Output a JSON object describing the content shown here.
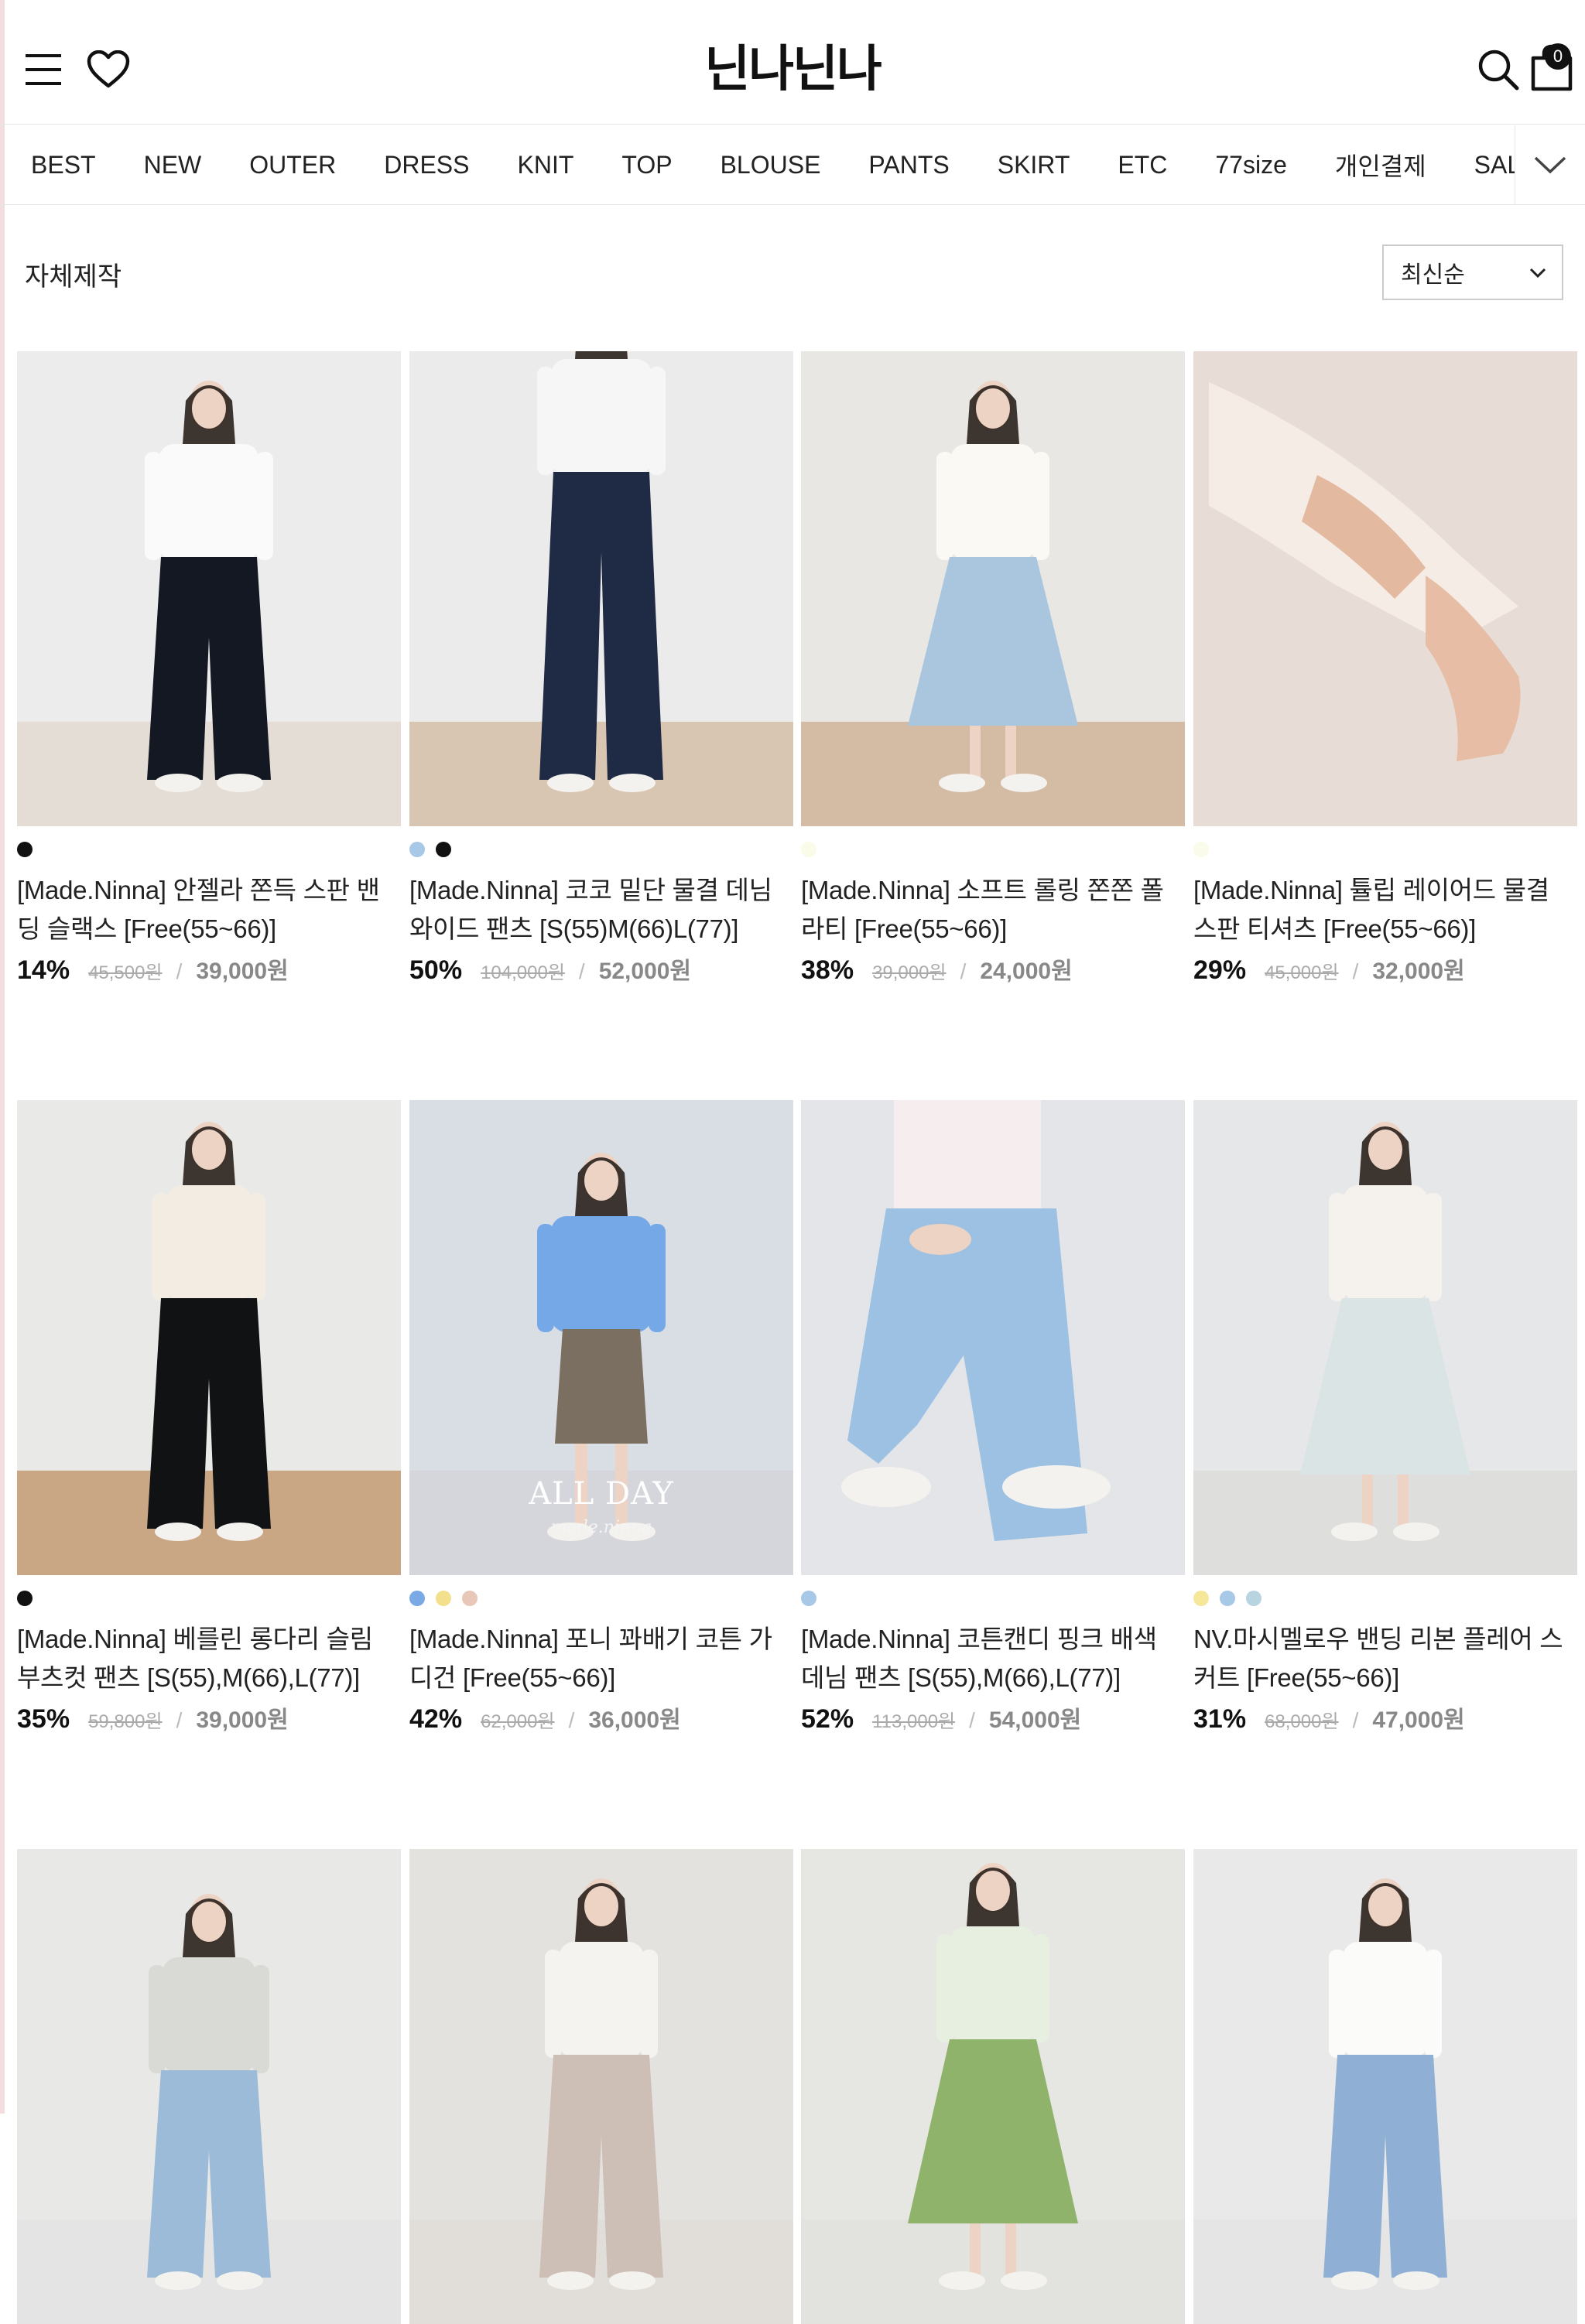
{
  "header": {
    "logo": "닌나닌나",
    "cart_count": "0"
  },
  "nav": {
    "items": [
      "BEST",
      "NEW",
      "OUTER",
      "DRESS",
      "KNIT",
      "TOP",
      "BLOUSE",
      "PANTS",
      "SKIRT",
      "ETC",
      "77size",
      "개인결제",
      "SALE"
    ]
  },
  "page": {
    "title": "자체제작",
    "sort_selected": "최신순"
  },
  "products": [
    {
      "name": "[Made.Ninna] 안젤라 쫀득 스판 밴딩 슬랙스 [Free(55~66)]",
      "discount": "14%",
      "original_price": "45,500원",
      "sale_price": "39,000원",
      "swatches": [
        "#111111"
      ]
    },
    {
      "name": "[Made.Ninna] 코코 밑단 물결 데님 와이드 팬츠 [S(55)M(66)L(77)]",
      "discount": "50%",
      "original_price": "104,000원",
      "sale_price": "52,000원",
      "swatches": [
        "#a8c8e8",
        "#111111"
      ]
    },
    {
      "name": "[Made.Ninna] 소프트 롤링 쫀쫀 폴라티 [Free(55~66)]",
      "discount": "38%",
      "original_price": "39,000원",
      "sale_price": "24,000원",
      "swatches": [
        "#fbfbe9"
      ]
    },
    {
      "name": "[Made.Ninna] 튤립 레이어드 물결 스판 티셔츠 [Free(55~66)]",
      "discount": "29%",
      "original_price": "45,000원",
      "sale_price": "32,000원",
      "swatches": [
        "#fbfbe9"
      ]
    },
    {
      "name": "[Made.Ninna] 베를린 롱다리 슬림 부츠컷 팬츠 [S(55),M(66),L(77)]",
      "discount": "35%",
      "original_price": "59,800원",
      "sale_price": "39,000원",
      "swatches": [
        "#111111"
      ]
    },
    {
      "name": "[Made.Ninna] 포니 꽈배기 코튼 가디건 [Free(55~66)]",
      "discount": "42%",
      "original_price": "62,000원",
      "sale_price": "36,000원",
      "swatches": [
        "#7aaae6",
        "#f3e08c",
        "#e8c7b8"
      ]
    },
    {
      "name": "[Made.Ninna] 코튼캔디 핑크 배색 데님 팬츠 [S(55),M(66),L(77)]",
      "discount": "52%",
      "original_price": "113,000원",
      "sale_price": "54,000원",
      "swatches": [
        "#a8c8e8"
      ]
    },
    {
      "name": "NV.마시멜로우 밴딩 리본 플레어 스커트 [Free(55~66)]",
      "discount": "31%",
      "original_price": "68,000원",
      "sale_price": "47,000원",
      "swatches": [
        "#f6e79a",
        "#a8c8e8",
        "#b8d4e0"
      ]
    },
    {
      "name": "",
      "discount": "",
      "original_price": "",
      "sale_price": "",
      "swatches": []
    },
    {
      "name": "",
      "discount": "",
      "original_price": "",
      "sale_price": "",
      "swatches": []
    },
    {
      "name": "",
      "discount": "",
      "original_price": "",
      "sale_price": "",
      "swatches": []
    },
    {
      "name": "",
      "discount": "",
      "original_price": "",
      "sale_price": "",
      "swatches": []
    }
  ],
  "overlay": {
    "headline": "ALL DAY",
    "sub": "made.ninna"
  }
}
